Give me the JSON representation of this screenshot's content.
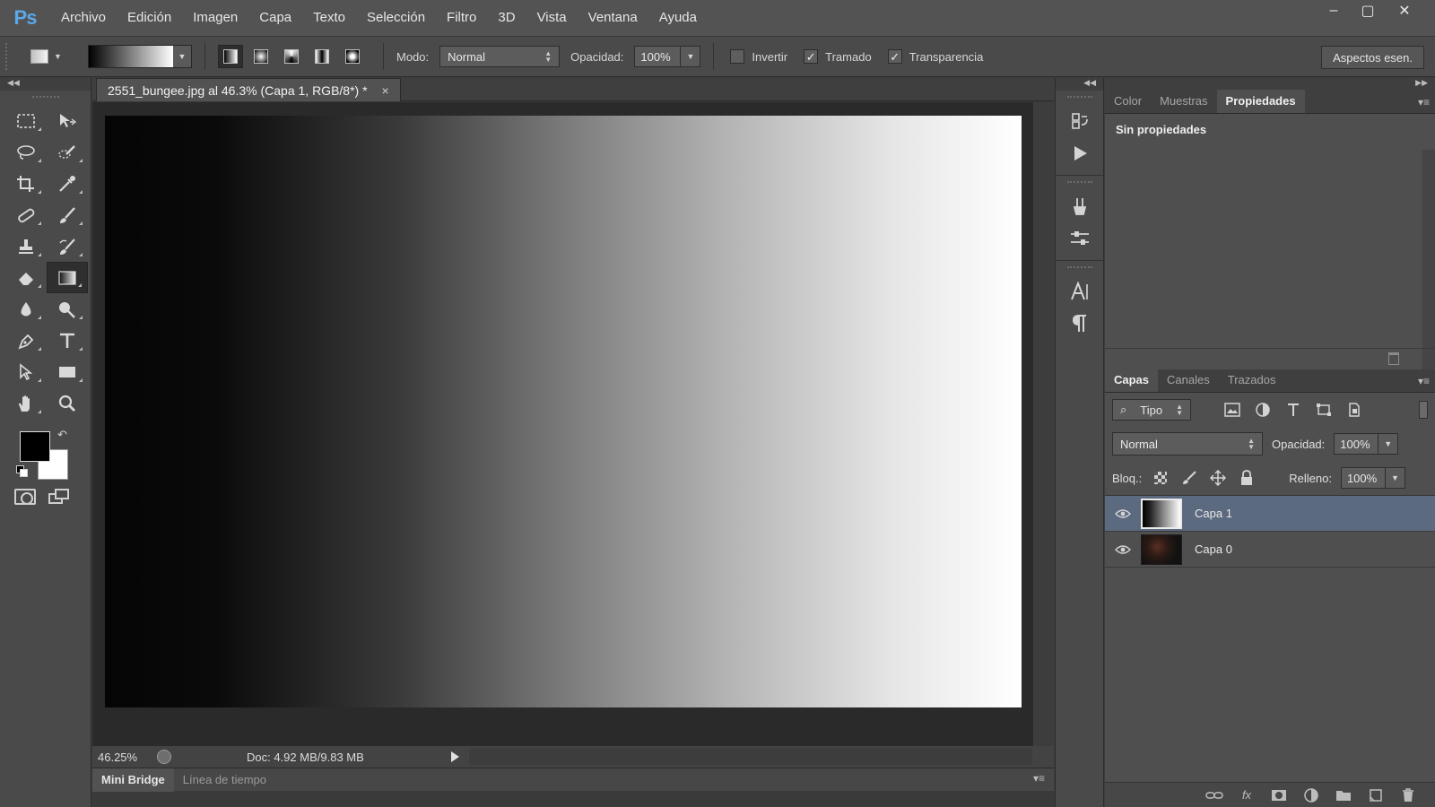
{
  "app": {
    "logo": "Ps"
  },
  "menu": [
    "Archivo",
    "Edición",
    "Imagen",
    "Capa",
    "Texto",
    "Selección",
    "Filtro",
    "3D",
    "Vista",
    "Ventana",
    "Ayuda"
  ],
  "window_controls": {
    "minimize": "–",
    "maximize": "▢",
    "close": "✕"
  },
  "options_bar": {
    "mode_label": "Modo:",
    "mode_value": "Normal",
    "opacity_label": "Opacidad:",
    "opacity_value": "100%",
    "reverse_label": "Invertir",
    "reverse_checked": false,
    "dither_label": "Tramado",
    "dither_checked": true,
    "transparency_label": "Transparencia",
    "transparency_checked": true,
    "workspace_label": "Aspectos esen."
  },
  "document": {
    "tab_title": "2551_bungee.jpg al 46.3% (Capa 1, RGB/8*) *",
    "tab_close": "×",
    "zoom": "46.25%",
    "doc_info": "Doc: 4.92 MB/9.83 MB"
  },
  "bottom_tabs": [
    "Mini Bridge",
    "Línea de tiempo"
  ],
  "properties_panel": {
    "tabs": [
      "Color",
      "Muestras",
      "Propiedades"
    ],
    "active_tab": "Propiedades",
    "empty_text": "Sin propiedades"
  },
  "layers_panel": {
    "tabs": [
      "Capas",
      "Canales",
      "Trazados"
    ],
    "filter_kind": "Tipo",
    "blend_mode": "Normal",
    "opacity_label": "Opacidad:",
    "opacity_value": "100%",
    "lock_label": "Bloq.:",
    "fill_label": "Relleno:",
    "fill_value": "100%",
    "layers": [
      {
        "name": "Capa 1",
        "selected": true
      },
      {
        "name": "Capa 0",
        "selected": false
      }
    ]
  },
  "colors": {
    "foreground": "#000000",
    "background": "#ffffff",
    "selection": "#5c6a7f",
    "brand": "#5ba8ea"
  }
}
